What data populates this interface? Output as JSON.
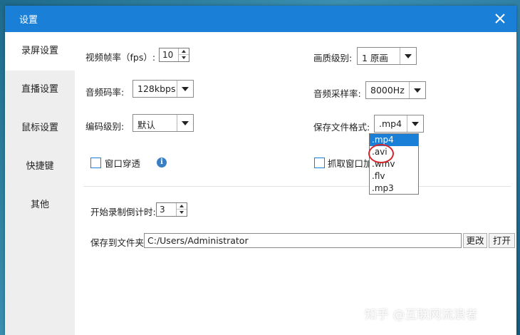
{
  "window": {
    "title": "设置"
  },
  "sidebar": {
    "items": [
      {
        "label": "录屏设置",
        "active": true
      },
      {
        "label": "直播设置"
      },
      {
        "label": "鼠标设置"
      },
      {
        "label": "快捷键"
      },
      {
        "label": "其他"
      }
    ]
  },
  "settings": {
    "fps": {
      "label": "视频帧率（fps）:",
      "value": "10"
    },
    "quality": {
      "label": "画质级别:",
      "value": "1 原画"
    },
    "audio_bitrate": {
      "label": "音频码率:",
      "value": "128kbps"
    },
    "sample_rate": {
      "label": "音频采样率:",
      "value": "8000Hz"
    },
    "encode_level": {
      "label": "编码级别:",
      "value": "默认"
    },
    "file_format": {
      "label": "保存文件格式:",
      "value": ".mp4",
      "options": [
        ".mp4",
        ".avi",
        ".wmv",
        ".flv",
        ".mp3"
      ],
      "highlighted": ".mp4"
    },
    "window_through": {
      "label": "窗口穿透",
      "checked": false
    },
    "capture_partial": {
      "label": "抓取窗口加",
      "checked": false
    },
    "countdown": {
      "label": "开始录制倒计时:",
      "value": "3"
    },
    "save_folder": {
      "label": "保存到文件夹:",
      "value": "C:/Users/Administrator",
      "change_label": "更改",
      "open_label": "打开"
    }
  },
  "watermark": "知乎 @互联网流浪者",
  "colors": {
    "accent": "#1a7fd6",
    "annotation": "#d3262b"
  }
}
